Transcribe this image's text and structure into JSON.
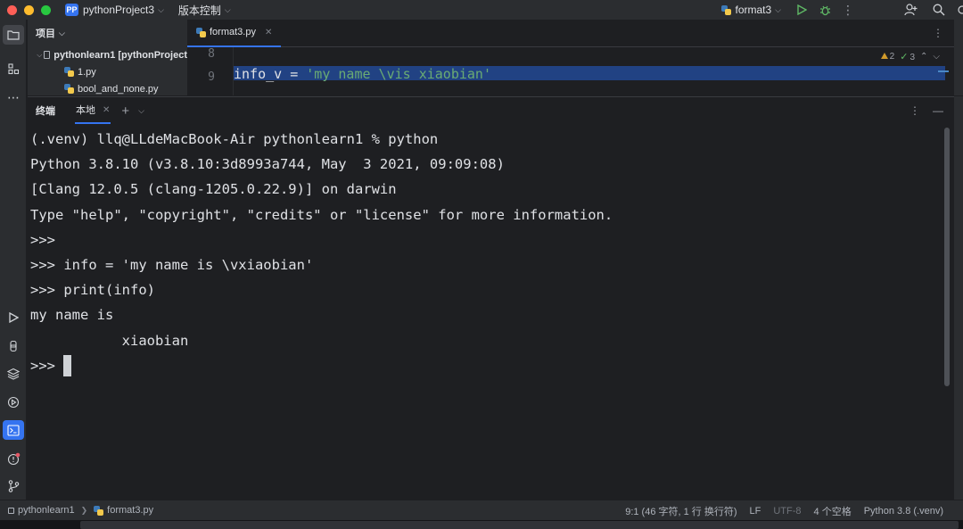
{
  "titlebar": {
    "project_badge": "PP",
    "project_name": "pythonProject3",
    "vcs_label": "版本控制",
    "run_config": "format3"
  },
  "project_panel": {
    "header": "项目",
    "root": "pythonlearn1 [pythonProject",
    "files": [
      "1.py",
      "bool_and_none.py"
    ]
  },
  "editor": {
    "tab_label": "format3.py",
    "line_numbers": [
      "8",
      "9"
    ],
    "line9_code_prefix": "info_v = ",
    "line9_code_string": "'my name \\vis xiaobian'",
    "warnings": "2",
    "checks": "3"
  },
  "terminal": {
    "title": "终端",
    "tab_label": "本地",
    "lines": [
      "(.venv) llq@LLdeMacBook-Air pythonlearn1 % python",
      "Python 3.8.10 (v3.8.10:3d8993a744, May  3 2021, 09:09:08)",
      "[Clang 12.0.5 (clang-1205.0.22.9)] on darwin",
      "Type \"help\", \"copyright\", \"credits\" or \"license\" for more information.",
      ">>>",
      ">>> info = 'my name is \\vxiaobian'",
      ">>> print(info)",
      "my name is",
      "           xiaobian"
    ],
    "prompt": ">>> "
  },
  "statusbar": {
    "module": "pythonlearn1",
    "file": "format3.py",
    "position": "9:1 (46 字符, 1 行 换行符)",
    "line_sep": "LF",
    "encoding": "UTF-8",
    "indent": "4 个空格",
    "interpreter": "Python 3.8 (.venv)"
  },
  "colors": {
    "accent": "#3574f0",
    "background": "#1e1f22",
    "panel": "#2b2d30"
  }
}
